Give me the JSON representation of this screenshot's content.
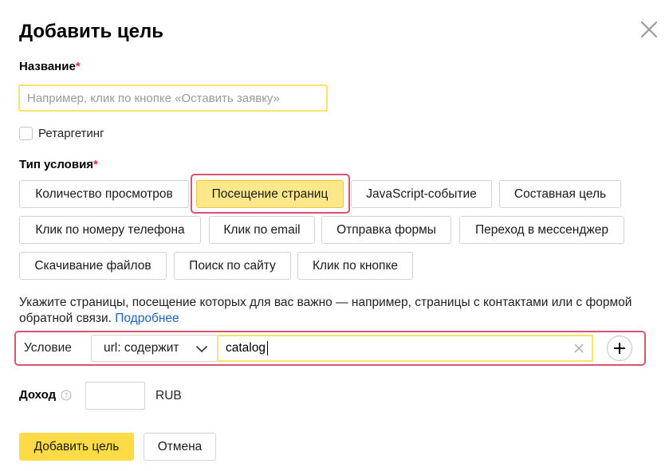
{
  "dialog": {
    "title": "Добавить цель",
    "close_icon": "close-icon"
  },
  "name_field": {
    "label": "Название",
    "required_mark": "*",
    "placeholder": "Например, клик по кнопке «Оставить заявку»",
    "value": ""
  },
  "retargeting": {
    "label": "Ретаргетинг",
    "checked": false
  },
  "condition_type": {
    "label": "Тип условия",
    "required_mark": "*",
    "options": [
      "Количество просмотров",
      "Посещение страниц",
      "JavaScript-событие",
      "Составная цель",
      "Клик по номеру телефона",
      "Клик по email",
      "Отправка формы",
      "Переход в мессенджер",
      "Скачивание файлов",
      "Поиск по сайту",
      "Клик по кнопке"
    ],
    "selected": "Посещение страниц"
  },
  "hint": {
    "text": "Укажите страницы, посещение которых для вас важно — например, страницы с контактами или с формой обратной связи.",
    "link": "Подробнее"
  },
  "condition": {
    "label": "Условие",
    "operator": "url: содержит",
    "value": "catalog",
    "clear_icon": "clear-icon",
    "add_icon": "plus-icon"
  },
  "income": {
    "label": "Доход",
    "help_icon": "help-icon",
    "value": "",
    "currency": "RUB"
  },
  "actions": {
    "submit": "Добавить цель",
    "cancel": "Отмена"
  },
  "colors": {
    "accent_yellow": "#fddb47",
    "selected_chip": "#fde78b",
    "highlight_frame": "#d7566f",
    "input_focus_border": "#fbe26a",
    "link": "#1b64bd",
    "required": "#e32d2d"
  }
}
